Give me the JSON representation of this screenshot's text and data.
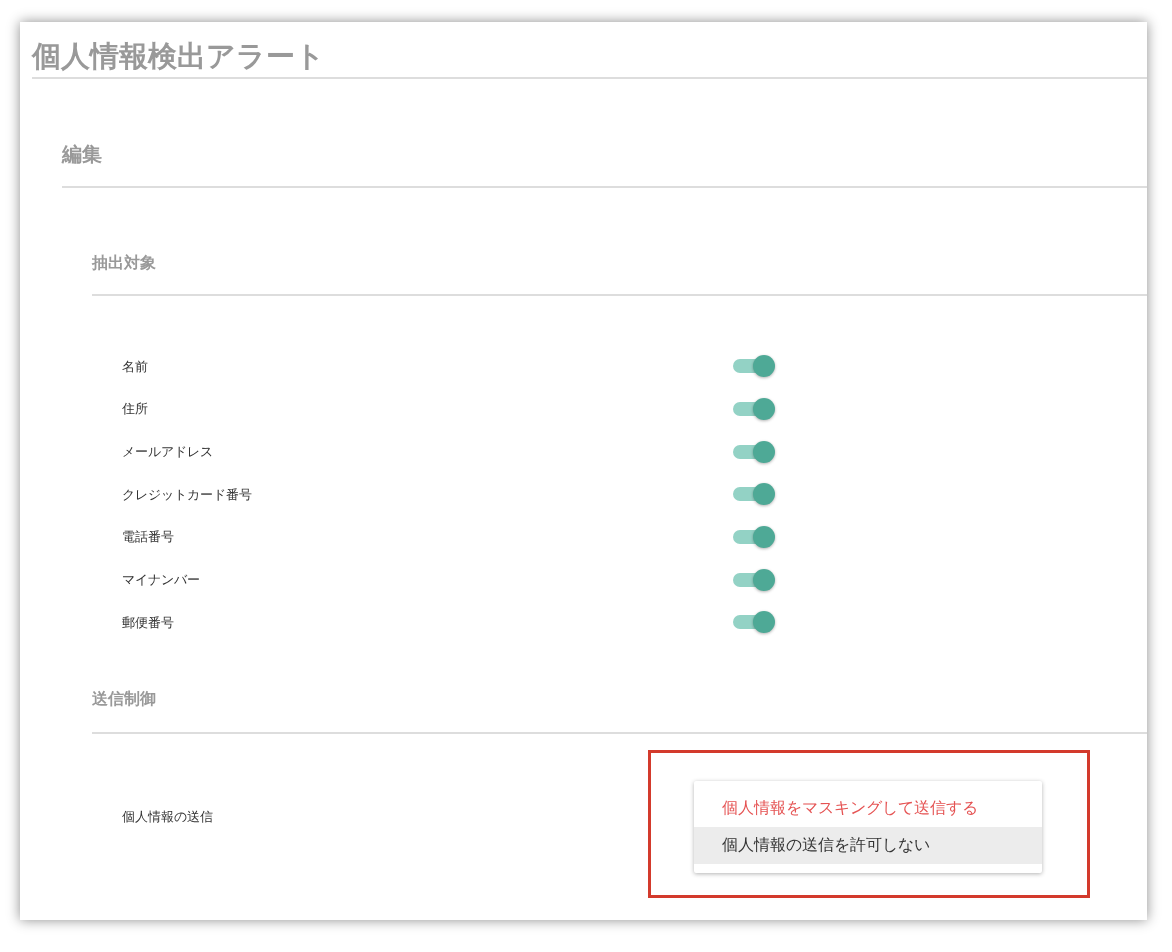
{
  "title": "個人情報検出アラート",
  "section": {
    "heading": "編集",
    "extraction": {
      "heading": "抽出対象",
      "items": [
        {
          "label": "名前",
          "on": true
        },
        {
          "label": "住所",
          "on": true
        },
        {
          "label": "メールアドレス",
          "on": true
        },
        {
          "label": "クレジットカード番号",
          "on": true
        },
        {
          "label": "電話番号",
          "on": true
        },
        {
          "label": "マイナンバー",
          "on": true
        },
        {
          "label": "郵便番号",
          "on": true
        }
      ]
    },
    "transmission": {
      "heading": "送信制御",
      "label": "個人情報の送信",
      "options": [
        {
          "label": "個人情報をマスキングして送信する",
          "selected": true,
          "highlighted": false
        },
        {
          "label": "個人情報の送信を許可しない",
          "selected": false,
          "highlighted": true
        }
      ]
    }
  }
}
